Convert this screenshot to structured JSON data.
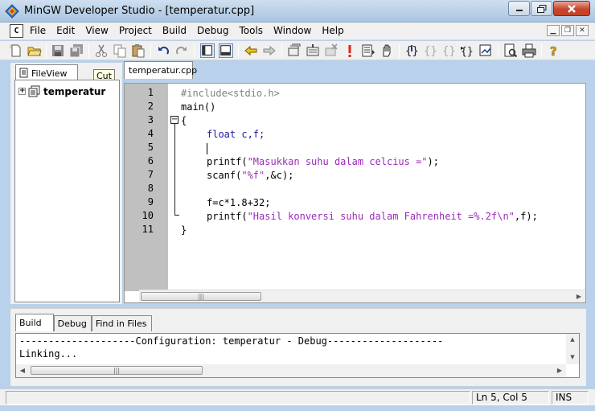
{
  "window": {
    "title": "MinGW Developer Studio - [temperatur.cpp]"
  },
  "menu": {
    "items": [
      "File",
      "Edit",
      "View",
      "Project",
      "Build",
      "Debug",
      "Tools",
      "Window",
      "Help"
    ],
    "doc_icon": "C"
  },
  "toolbar": {
    "icons": [
      "new-file-icon",
      "open-folder-icon",
      "save-icon",
      "save-all-icon",
      "cut-icon",
      "copy-icon",
      "paste-icon",
      "undo-icon",
      "redo-icon",
      "toggle-workspace-icon",
      "toggle-output-icon",
      "back-arrow-icon",
      "forward-arrow-icon",
      "compile-icon",
      "build-icon",
      "stop-build-icon",
      "execute-icon",
      "build-execute-icon",
      "hand-icon",
      "step-into-icon",
      "step-over-icon",
      "step-out-icon",
      "run-to-cursor-icon",
      "watch-icon",
      "print-preview-icon",
      "print-icon",
      "help-icon"
    ]
  },
  "left_panel": {
    "tab_label": "FileView",
    "tooltip": "Cut",
    "tree_root": "temperatur"
  },
  "editor": {
    "tab_label": "temperatur.cpp",
    "line_numbers": [
      "1",
      "2",
      "3",
      "4",
      "5",
      "6",
      "7",
      "8",
      "9",
      "10",
      "11"
    ],
    "lines": {
      "l1": "#include<stdio.h>",
      "l2": "main()",
      "l3": "{",
      "l4": "float c,f;",
      "l6a": "printf(",
      "l6s": "\"Masukkan suhu dalam celcius =\"",
      "l6b": ");",
      "l7a": "scanf(",
      "l7s": "\"%f\"",
      "l7b": ",&c);",
      "l9": "f=c*1.8+32;",
      "l10a": "printf(",
      "l10s": "\"Hasil konversi suhu dalam Fahrenheit =%.2f\\n\"",
      "l10b": ",f);",
      "l11": "}"
    },
    "fold_marker": "−"
  },
  "output": {
    "tabs": [
      "Build",
      "Debug",
      "Find in Files"
    ],
    "active_tab": "Build",
    "lines": [
      "--------------------Configuration: temperatur - Debug--------------------",
      "Linking..."
    ]
  },
  "status": {
    "position": "Ln 5, Col 5",
    "mode": "INS"
  },
  "colors": {
    "string": "#9a2bb8",
    "keyword": "#1a1a9a",
    "preprocessor": "#808080",
    "gutter": "#c0c0c0"
  }
}
